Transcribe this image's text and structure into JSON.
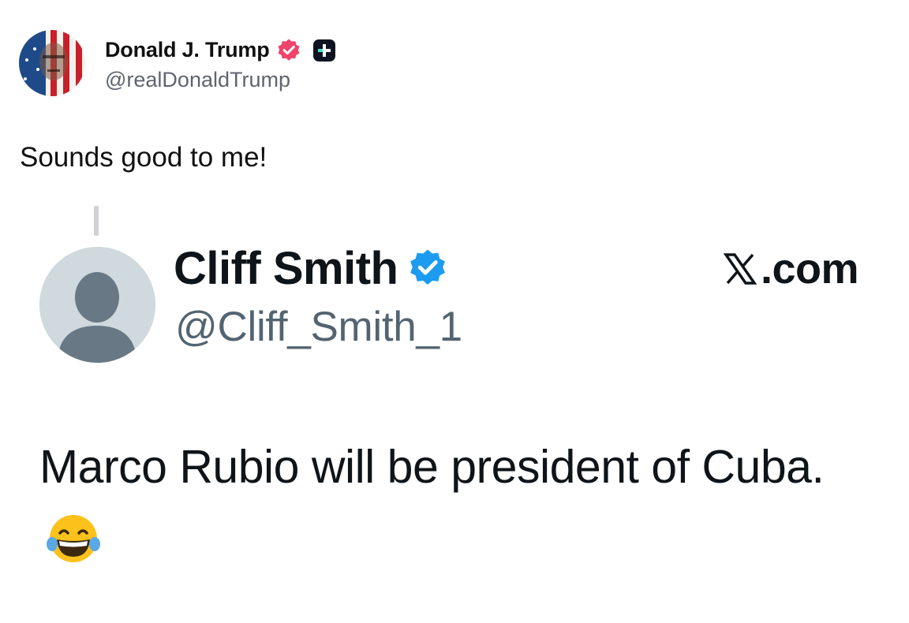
{
  "post": {
    "author_name": "Donald J. Trump",
    "author_handle": "@realDonaldTrump",
    "text": "Sounds good to me!",
    "avatar_icon": "flag-portrait-avatar",
    "verified_badge_color": "#f0436a"
  },
  "quoted_post": {
    "author_name": "Cliff Smith",
    "author_handle": "@Cliff_Smith_1",
    "source": ".com",
    "source_icon": "x-logo",
    "verified_badge_color": "#1d9bf0",
    "text": "Marco Rubio will be president of Cuba.",
    "emoji": "face-with-tears-of-joy"
  }
}
